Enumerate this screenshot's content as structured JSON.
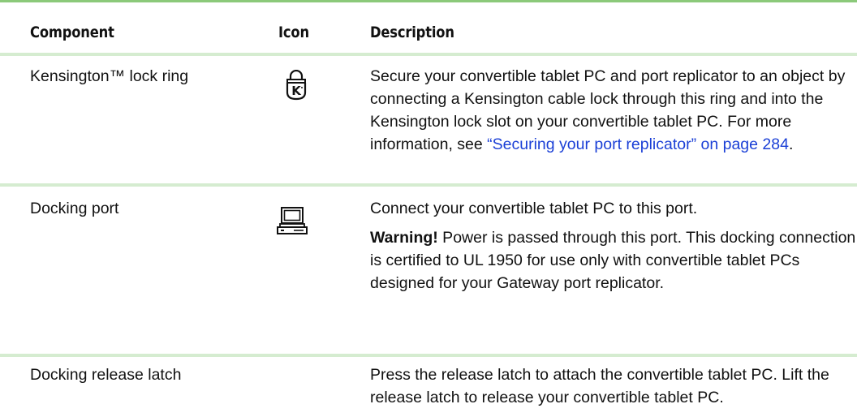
{
  "table": {
    "headers": {
      "component": "Component",
      "icon": "Icon",
      "description": "Description"
    },
    "rows": [
      {
        "component": "Kensington™ lock ring",
        "icon": "kensington-lock-icon",
        "description": "Secure your convertible tablet PC and port replicator to an object by connecting a Kensington cable lock through this ring and into the Kensington lock slot on your convertible tablet PC. For more information, see ",
        "link": "“Securing your port replicator” on page 284",
        "description_end": "."
      },
      {
        "component": "Docking port",
        "icon": "computer-icon",
        "description": "Connect your convertible tablet PC to this port.",
        "warning_label": "Warning!",
        "warning_text": " Power is passed through this port. This docking connection is certified to UL 1950 for use only with convertible tablet PCs designed for your Gateway port replicator."
      },
      {
        "component": "Docking release latch",
        "icon": "",
        "description": "Press the release latch to attach the convertible tablet PC. Lift the release latch to release your convertible tablet PC."
      }
    ]
  },
  "colors": {
    "top_rule": "#8bc97a",
    "row_rule": "#d5ecd0",
    "link": "#1a3fd6"
  }
}
